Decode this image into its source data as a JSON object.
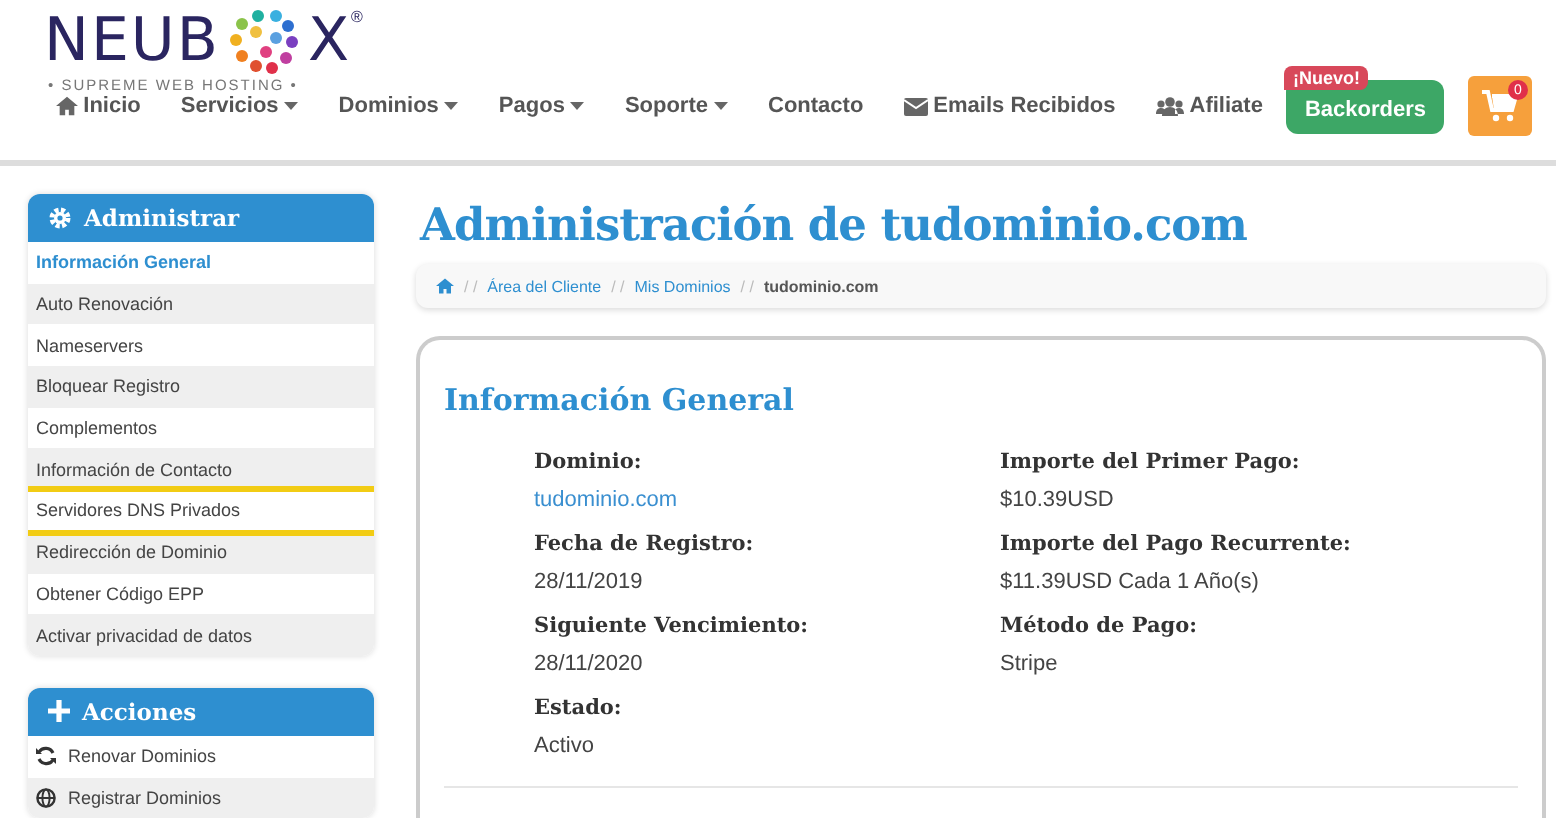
{
  "logo": {
    "left": "NEUB",
    "right": "X",
    "registered": "®",
    "tagline": "• SUPREME WEB HOSTING •"
  },
  "nav": [
    {
      "label": "Inicio",
      "dropdown": false
    },
    {
      "label": "Servicios",
      "dropdown": true
    },
    {
      "label": "Dominios",
      "dropdown": true
    },
    {
      "label": "Pagos",
      "dropdown": true
    },
    {
      "label": "Soporte",
      "dropdown": true
    },
    {
      "label": "Contacto",
      "dropdown": false
    },
    {
      "label": "Emails Recibidos",
      "dropdown": false
    },
    {
      "label": "Afiliate",
      "dropdown": false
    }
  ],
  "backorders": {
    "label": "Backorders",
    "badge": "¡Nuevo!"
  },
  "cart": {
    "count": "0"
  },
  "sidebar": [
    {
      "title": "Administrar",
      "items": [
        {
          "label": "Información General",
          "selected": true,
          "highlighted": false
        },
        {
          "label": "Auto Renovación",
          "selected": false,
          "highlighted": false
        },
        {
          "label": "Nameservers",
          "selected": false,
          "highlighted": false
        },
        {
          "label": "Bloquear Registro",
          "selected": false,
          "highlighted": false
        },
        {
          "label": "Complementos",
          "selected": false,
          "highlighted": false
        },
        {
          "label": "Información de Contacto",
          "selected": false,
          "highlighted": false
        },
        {
          "label": "Servidores DNS Privados",
          "selected": false,
          "highlighted": true
        },
        {
          "label": "Redirección de Dominio",
          "selected": false,
          "highlighted": false
        },
        {
          "label": "Obtener Código EPP",
          "selected": false,
          "highlighted": false
        },
        {
          "label": "Activar privacidad de datos",
          "selected": false,
          "highlighted": false
        }
      ]
    },
    {
      "title": "Acciones",
      "items": [
        {
          "label": "Renovar Dominios",
          "selected": false,
          "highlighted": false
        },
        {
          "label": "Registrar Dominios",
          "selected": false,
          "highlighted": false
        }
      ]
    }
  ],
  "page_title": "Administración de tudominio.com",
  "breadcrumb": [
    {
      "label": "Área del Cliente",
      "current": false
    },
    {
      "label": "Mis Dominios",
      "current": false
    },
    {
      "label": "tudominio.com",
      "current": true
    }
  ],
  "breadcrumb_separator": "/ /",
  "card": {
    "title": "Información General",
    "columns": [
      [
        {
          "label": "Dominio:",
          "value": "tudominio.com",
          "link": true
        },
        {
          "label": "Fecha de Registro:",
          "value": "28/11/2019",
          "link": false
        },
        {
          "label": "Siguiente Vencimiento:",
          "value": "28/11/2020",
          "link": false
        },
        {
          "label": "Estado:",
          "value": "Activo",
          "link": false
        }
      ],
      [
        {
          "label": "Importe del Primer Pago:",
          "value": "$10.39USD",
          "link": false
        },
        {
          "label": "Importe del Pago Recurrente:",
          "value": "$11.39USD Cada 1 Año(s)",
          "link": false
        },
        {
          "label": "Método de Pago:",
          "value": "Stripe",
          "link": false
        }
      ]
    ]
  }
}
